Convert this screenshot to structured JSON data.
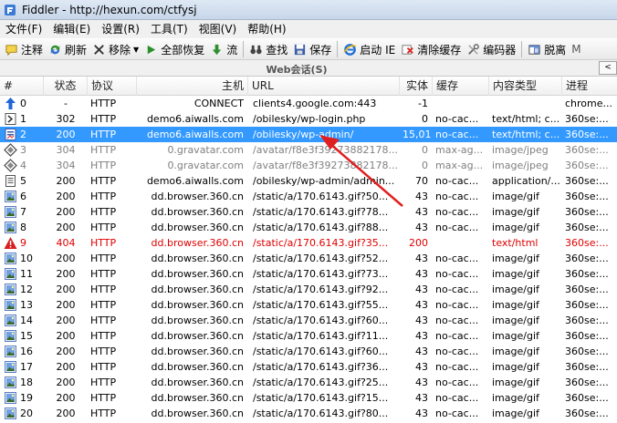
{
  "window": {
    "title": "Fiddler - http://hexun.com/ctfysj"
  },
  "menu": [
    "文件(F)",
    "编辑(E)",
    "设置(R)",
    "工具(T)",
    "视图(V)",
    "帮助(H)"
  ],
  "toolbar": {
    "comment": "注释",
    "reissue": "刷新",
    "remove": "移除",
    "resume_all": "全部恢复",
    "stream": "流",
    "find": "查找",
    "save": "保存",
    "launch_ie": "启动 IE",
    "clear_cache": "清除缓存",
    "encoder": "编码器",
    "detach": "脱离"
  },
  "session_title": "Web会话(S)",
  "scroll_left": "<",
  "columns": {
    "num": "#",
    "status": "状态",
    "protocol": "协议",
    "host": "主机",
    "url": "URL",
    "body": "实体",
    "cache": "缓存",
    "content_type": "内容类型",
    "process": "进程"
  },
  "rows": [
    {
      "num": "0",
      "status": "-",
      "protocol": "HTTP",
      "host": "CONNECT",
      "url": "clients4.google.com:443",
      "body": "-1",
      "cache": "",
      "ctype": "",
      "proc": "chrome...",
      "icon": "up-arrow-icon"
    },
    {
      "num": "1",
      "status": "302",
      "protocol": "HTTP",
      "host": "demo6.aiwalls.com",
      "url": "/obilesky/wp-login.php",
      "body": "0",
      "cache": "no-cac...",
      "ctype": "text/html; c...",
      "proc": "360se:...",
      "icon": "redirect-icon"
    },
    {
      "num": "2",
      "status": "200",
      "protocol": "HTTP",
      "host": "demo6.aiwalls.com",
      "url": "/obilesky/wp-admin/",
      "body": "15,014",
      "cache": "no-cac...",
      "ctype": "text/html; c...",
      "proc": "360se:...",
      "icon": "page-icon"
    },
    {
      "num": "3",
      "status": "304",
      "protocol": "HTTP",
      "host": "0.gravatar.com",
      "url": "/avatar/f8e3f39273882178...",
      "body": "0",
      "cache": "max-ag...",
      "ctype": "image/jpeg",
      "proc": "360se:...",
      "icon": "diamond-icon"
    },
    {
      "num": "4",
      "status": "304",
      "protocol": "HTTP",
      "host": "0.gravatar.com",
      "url": "/avatar/f8e3f39273882178...",
      "body": "0",
      "cache": "max-ag...",
      "ctype": "image/jpeg",
      "proc": "360se:...",
      "icon": "diamond-icon"
    },
    {
      "num": "5",
      "status": "200",
      "protocol": "HTTP",
      "host": "demo6.aiwalls.com",
      "url": "/obilesky/wp-admin/admin...",
      "body": "70",
      "cache": "no-cac...",
      "ctype": "application/...",
      "proc": "360se:...",
      "icon": "doc-icon"
    },
    {
      "num": "6",
      "status": "200",
      "protocol": "HTTP",
      "host": "dd.browser.360.cn",
      "url": "/static/a/170.6143.gif?50...",
      "body": "43",
      "cache": "no-cac...",
      "ctype": "image/gif",
      "proc": "360se:...",
      "icon": "image-icon"
    },
    {
      "num": "7",
      "status": "200",
      "protocol": "HTTP",
      "host": "dd.browser.360.cn",
      "url": "/static/a/170.6143.gif?78...",
      "body": "43",
      "cache": "no-cac...",
      "ctype": "image/gif",
      "proc": "360se:...",
      "icon": "image-icon"
    },
    {
      "num": "8",
      "status": "200",
      "protocol": "HTTP",
      "host": "dd.browser.360.cn",
      "url": "/static/a/170.6143.gif?88...",
      "body": "43",
      "cache": "no-cac...",
      "ctype": "image/gif",
      "proc": "360se:...",
      "icon": "image-icon"
    },
    {
      "num": "9",
      "status": "404",
      "protocol": "HTTP",
      "host": "dd.browser.360.cn",
      "url": "/static/a/170.6143.gif?35...",
      "body": "200",
      "cache": "",
      "ctype": "text/html",
      "proc": "360se:...",
      "icon": "warning-icon"
    },
    {
      "num": "10",
      "status": "200",
      "protocol": "HTTP",
      "host": "dd.browser.360.cn",
      "url": "/static/a/170.6143.gif?52...",
      "body": "43",
      "cache": "no-cac...",
      "ctype": "image/gif",
      "proc": "360se:...",
      "icon": "image-icon"
    },
    {
      "num": "11",
      "status": "200",
      "protocol": "HTTP",
      "host": "dd.browser.360.cn",
      "url": "/static/a/170.6143.gif?73...",
      "body": "43",
      "cache": "no-cac...",
      "ctype": "image/gif",
      "proc": "360se:...",
      "icon": "image-icon"
    },
    {
      "num": "12",
      "status": "200",
      "protocol": "HTTP",
      "host": "dd.browser.360.cn",
      "url": "/static/a/170.6143.gif?92...",
      "body": "43",
      "cache": "no-cac...",
      "ctype": "image/gif",
      "proc": "360se:...",
      "icon": "image-icon"
    },
    {
      "num": "13",
      "status": "200",
      "protocol": "HTTP",
      "host": "dd.browser.360.cn",
      "url": "/static/a/170.6143.gif?55...",
      "body": "43",
      "cache": "no-cac...",
      "ctype": "image/gif",
      "proc": "360se:...",
      "icon": "image-icon"
    },
    {
      "num": "14",
      "status": "200",
      "protocol": "HTTP",
      "host": "dd.browser.360.cn",
      "url": "/static/a/170.6143.gif?60...",
      "body": "43",
      "cache": "no-cac...",
      "ctype": "image/gif",
      "proc": "360se:...",
      "icon": "image-icon"
    },
    {
      "num": "15",
      "status": "200",
      "protocol": "HTTP",
      "host": "dd.browser.360.cn",
      "url": "/static/a/170.6143.gif?11...",
      "body": "43",
      "cache": "no-cac...",
      "ctype": "image/gif",
      "proc": "360se:...",
      "icon": "image-icon"
    },
    {
      "num": "16",
      "status": "200",
      "protocol": "HTTP",
      "host": "dd.browser.360.cn",
      "url": "/static/a/170.6143.gif?60...",
      "body": "43",
      "cache": "no-cac...",
      "ctype": "image/gif",
      "proc": "360se:...",
      "icon": "image-icon"
    },
    {
      "num": "17",
      "status": "200",
      "protocol": "HTTP",
      "host": "dd.browser.360.cn",
      "url": "/static/a/170.6143.gif?36...",
      "body": "43",
      "cache": "no-cac...",
      "ctype": "image/gif",
      "proc": "360se:...",
      "icon": "image-icon"
    },
    {
      "num": "18",
      "status": "200",
      "protocol": "HTTP",
      "host": "dd.browser.360.cn",
      "url": "/static/a/170.6143.gif?25...",
      "body": "43",
      "cache": "no-cac...",
      "ctype": "image/gif",
      "proc": "360se:...",
      "icon": "image-icon"
    },
    {
      "num": "19",
      "status": "200",
      "protocol": "HTTP",
      "host": "dd.browser.360.cn",
      "url": "/static/a/170.6143.gif?15...",
      "body": "43",
      "cache": "no-cac...",
      "ctype": "image/gif",
      "proc": "360se:...",
      "icon": "image-icon"
    },
    {
      "num": "20",
      "status": "200",
      "protocol": "HTTP",
      "host": "dd.browser.360.cn",
      "url": "/static/a/170.6143.gif?80...",
      "body": "43",
      "cache": "no-cac...",
      "ctype": "image/gif",
      "proc": "360se:...",
      "icon": "image-icon"
    }
  ],
  "selected_row": 2,
  "gray_rows": [
    3,
    4
  ],
  "error_rows": [
    9
  ],
  "colors": {
    "selection": "#3399ff",
    "error": "#e00000",
    "annotation_arrow": "#e02020"
  }
}
